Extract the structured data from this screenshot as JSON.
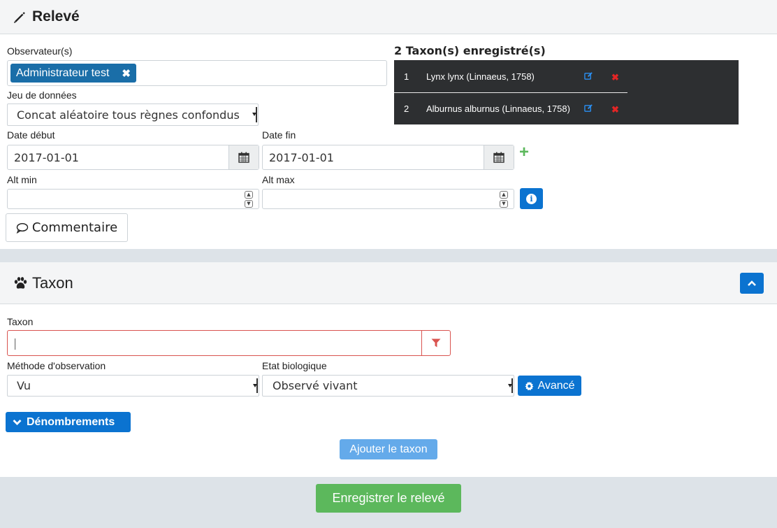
{
  "releve": {
    "title": "Relevé",
    "observers_label": "Observateur(s)",
    "observer_chip": "Administrateur test",
    "observer_remove": "✖",
    "dataset_label": "Jeu de données",
    "dataset_value": "Concat aléatoire tous règnes confondus",
    "date_start_label": "Date début",
    "date_start_value": "2017-01-01",
    "date_end_label": "Date fin",
    "date_end_value": "2017-01-01",
    "alt_min_label": "Alt min",
    "alt_max_label": "Alt max",
    "comment_label": "Commentaire",
    "add_symbol": "+",
    "info_symbol": "i"
  },
  "taxa": {
    "heading": "2 Taxon(s) enregistré(s)",
    "rows": [
      {
        "num": "1",
        "name": "Lynx lynx (Linnaeus, 1758)"
      },
      {
        "num": "2",
        "name": "Alburnus alburnus (Linnaeus, 1758)"
      }
    ],
    "delete_symbol": "✖",
    "edit_color": "#2a8ef0",
    "delete_color": "#e32525"
  },
  "taxon_panel": {
    "title": "Taxon",
    "taxon_label": "Taxon",
    "taxon_value": "|",
    "method_label": "Méthode d'observation",
    "method_value": "Vu",
    "bio_state_label": "Etat biologique",
    "bio_state_value": "Observé vivant",
    "advanced_label": "Avancé",
    "counts_label": "Dénombrements",
    "add_taxon_label": "Ajouter le taxon"
  },
  "footer": {
    "save_label": "Enregistrer le relevé"
  },
  "colors": {
    "primary": "#0b73d0",
    "chip": "#1a6ea8",
    "success": "#5cb85c",
    "danger": "#d9534f",
    "table_bg": "#2d2f31"
  }
}
